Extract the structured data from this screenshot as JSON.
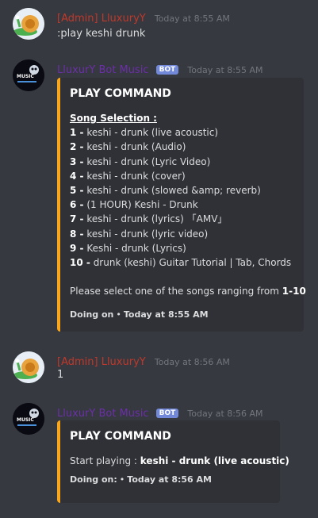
{
  "messages": [
    {
      "author": "[Admin] LluxuryY",
      "timestamp": "Today at 8:55 AM",
      "content": ":play keshi drunk"
    },
    {
      "author": "LluxurY Bot Music",
      "badge": "BOT",
      "timestamp": "Today at 8:55 AM",
      "embed": {
        "title": "PLAY COMMAND",
        "section": "Song Selection :",
        "songs": [
          {
            "num": "1 -",
            "text": "keshi - drunk (live acoustic)"
          },
          {
            "num": "2 -",
            "text": "keshi - drunk (Audio)"
          },
          {
            "num": "3 -",
            "text": "keshi - drunk (Lyric Video)"
          },
          {
            "num": "4 -",
            "text": "keshi - drunk (cover)"
          },
          {
            "num": "5 -",
            "text": "keshi - drunk (slowed &amp; reverb)"
          },
          {
            "num": "6 -",
            "text": "(1 HOUR) Keshi - Drunk"
          },
          {
            "num": "7 -",
            "text": "keshi - drunk (lyrics) 「AMV」"
          },
          {
            "num": "8 -",
            "text": "keshi - drunk (lyric video)"
          },
          {
            "num": "9 -",
            "text": "Keshi - drunk (Lyrics)"
          },
          {
            "num": "10 -",
            "text": "drunk (keshi) Guitar Tutorial | Tab, Chords"
          }
        ],
        "prompt": "Please select one of the songs ranging from ",
        "prompt_range": "1-10",
        "footer_label": "Doing on",
        "footer_time": "Today at 8:55 AM"
      }
    },
    {
      "author": "[Admin] LluxuryY",
      "timestamp": "Today at 8:56 AM",
      "content": "1"
    },
    {
      "author": "LluxurY Bot Music",
      "badge": "BOT",
      "timestamp": "Today at 8:56 AM",
      "embed": {
        "title": "PLAY COMMAND",
        "start_label": "Start playing : ",
        "start_song": "keshi - drunk (live acoustic)",
        "footer_label": "Doing on:",
        "footer_time": "Today at 8:56 AM"
      }
    }
  ],
  "colors": {
    "background": "#36393f",
    "embed_bg": "#2f3136",
    "embed_accent": "#faa61a",
    "admin_name": "#c0392b",
    "bot_name": "#6b2fa8",
    "badge": "#7289da"
  }
}
